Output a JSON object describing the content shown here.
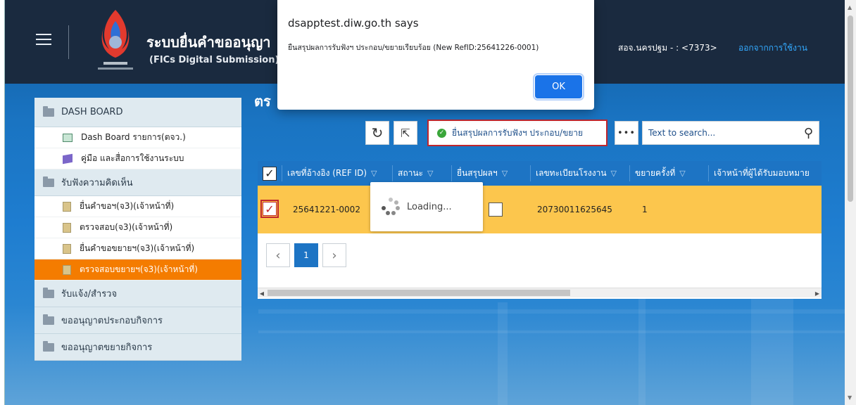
{
  "header": {
    "app_title": "ระบบยื่นคำขออนุญา",
    "app_subtitle": "(FICs Digital Submission)",
    "user_label": "สอจ.นครปฐม - : <7373>",
    "logout_label": "ออกจากการใช้งาน"
  },
  "page": {
    "heading": "ตร"
  },
  "sidebar": {
    "sections": [
      {
        "label": "DASH BOARD",
        "icon": "folder-icon"
      },
      {
        "label": "รับฟังความคิดเห็น",
        "icon": "folder-icon"
      },
      {
        "label": "รับแจ้ง/สำรวจ",
        "icon": "folder-icon"
      },
      {
        "label": "ขออนุญาตประกอบกิจการ",
        "icon": "folder-icon"
      },
      {
        "label": "ขออนุญาตขยายกิจการ",
        "icon": "folder-icon"
      }
    ],
    "items": [
      {
        "label": "Dash Board รายการ(ตจว.)",
        "icon": "dashboard-icon"
      },
      {
        "label": "คู่มือ และสื่อการใช้งานระบบ",
        "icon": "book-icon"
      },
      {
        "label": "ยื่นคำขอฯ(จ3)(เจ้าหน้าที่)",
        "icon": "document-icon"
      },
      {
        "label": "ตรวจสอบ(จ3)(เจ้าหน้าที่)",
        "icon": "document-icon"
      },
      {
        "label": "ยื่นคำขอขยายฯ(จ3)(เจ้าหน้าที่)",
        "icon": "document-icon"
      },
      {
        "label": "ตรวจสอบขยายฯ(จ3)(เจ้าหน้าที่)",
        "icon": "document-icon",
        "active": true
      }
    ]
  },
  "toolbar": {
    "submit_label": "ยื่นสรุปผลการรับฟังฯ ประกอบ/ขยาย",
    "more_label": "•••",
    "search_placeholder": "Text to search..."
  },
  "grid": {
    "columns": [
      "เลขที่อ้างอิง (REF ID)",
      "สถานะ",
      "ยื่นสรุปผลฯ",
      "เลขทะเบียนโรงงาน",
      "ขยายครั้งที่",
      "เจ้าหน้าที่ผู้ได้รับมอบหมาย"
    ],
    "rows": [
      {
        "ref_id": "25641221-0002",
        "status": "",
        "factory_no": "20730011625645",
        "expand_count": "1",
        "officer": ""
      }
    ],
    "loading_text": "Loading...",
    "current_page": "1"
  },
  "alert": {
    "title": "dsapptest.diw.go.th says",
    "message": "ยืนสรุปผลการรับฟังฯ ประกอบ/ขยายเรียบร้อย (New RefID:25641226-0001)",
    "ok_label": "OK"
  },
  "colors": {
    "header_bg": "#1a2a3f",
    "accent_blue": "#1d74c4",
    "active_orange": "#f47c00",
    "selected_row": "#fcc64d",
    "highlight_red": "#c0262d"
  }
}
